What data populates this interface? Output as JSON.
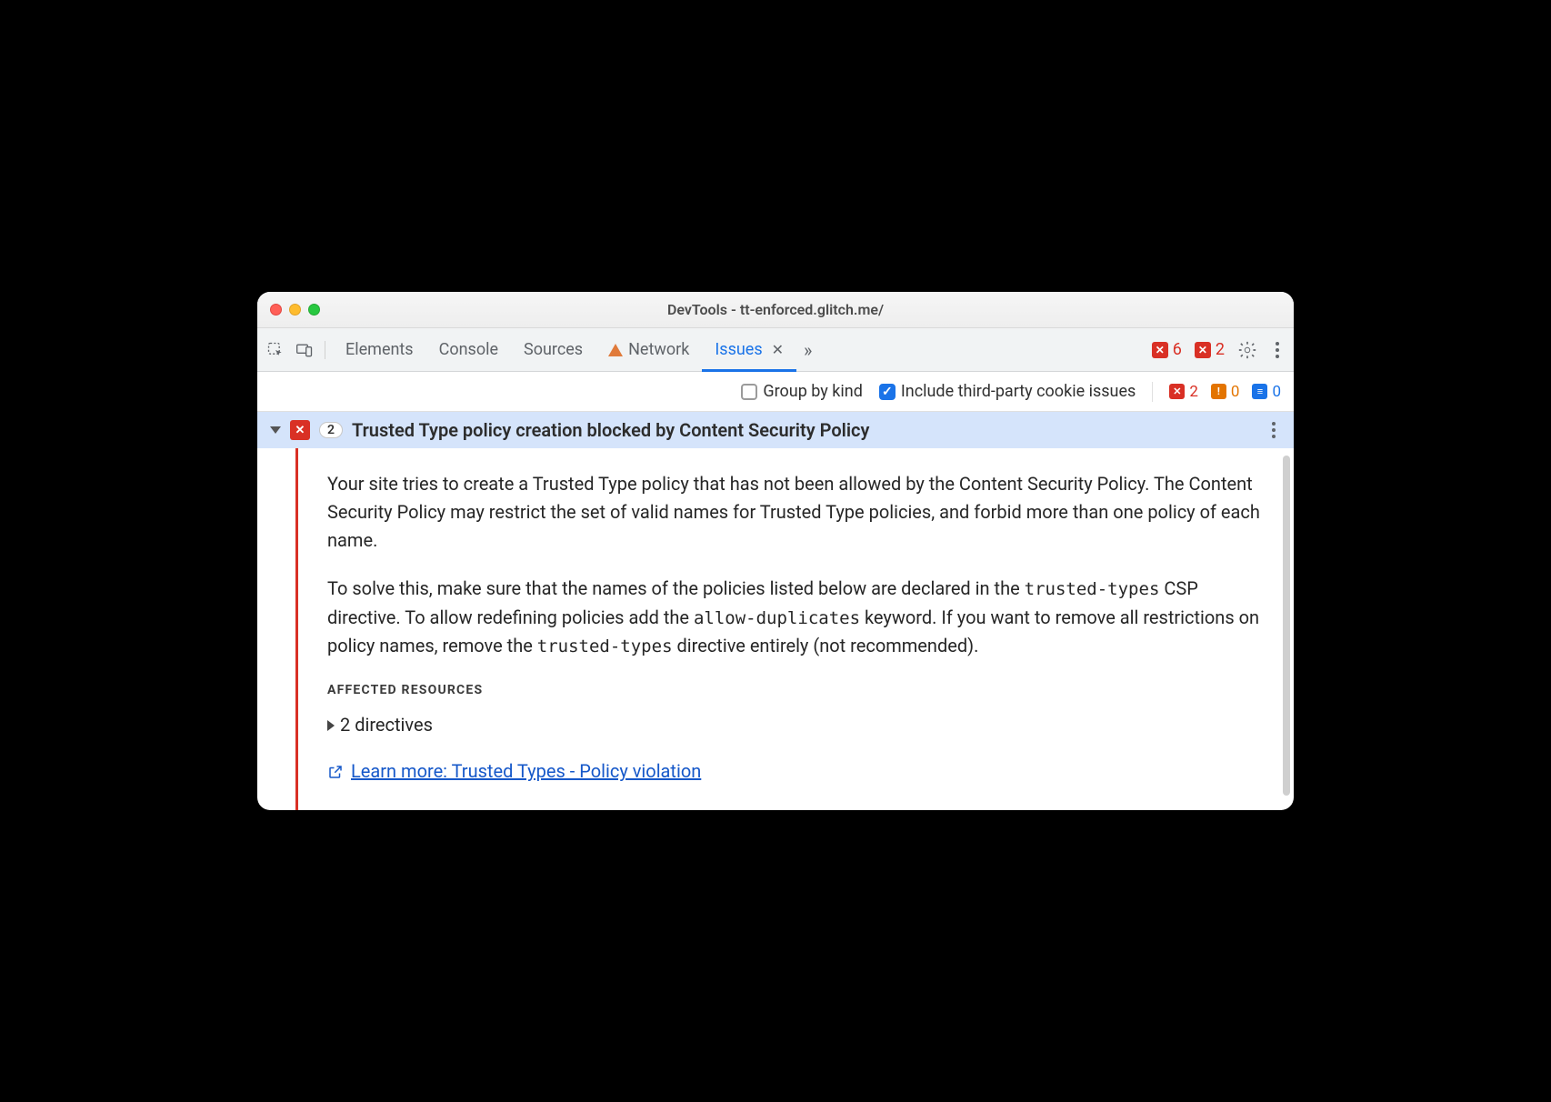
{
  "window": {
    "title": "DevTools - tt-enforced.glitch.me/"
  },
  "tabs": {
    "elements": "Elements",
    "console": "Console",
    "sources": "Sources",
    "network": "Network",
    "issues": "Issues"
  },
  "tabbar_right": {
    "error_count": "6",
    "issue_count": "2"
  },
  "filter": {
    "group_by_kind": "Group by kind",
    "include_cookie": "Include third-party cookie issues",
    "counts": {
      "red": "2",
      "orange": "0",
      "blue": "0"
    }
  },
  "issue": {
    "count": "2",
    "title": "Trusted Type policy creation blocked by Content Security Policy",
    "p1a": "Your site tries to create a Trusted Type policy that has not been allowed by the Content Security Policy. The Content Security Policy may restrict the set of valid names for Trusted Type policies, and forbid more than one policy of each name.",
    "p2_a": "To solve this, make sure that the names of the policies listed below are declared in the ",
    "p2_code1": "trusted-types",
    "p2_b": " CSP directive. To allow redefining policies add the ",
    "p2_code2": "allow-duplicates",
    "p2_c": " keyword. If you want to remove all restrictions on policy names, remove the ",
    "p2_code3": "trusted-types",
    "p2_d": " directive entirely (not recommended).",
    "affected_label": "AFFECTED RESOURCES",
    "directives": "2 directives",
    "learn": "Learn more: Trusted Types - Policy violation"
  }
}
